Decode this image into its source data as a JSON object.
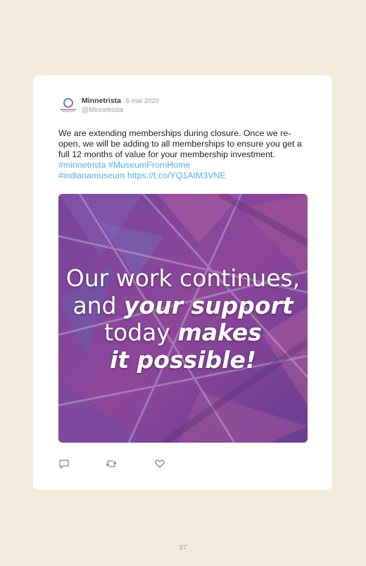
{
  "tweet": {
    "author_name": "Minnetrista",
    "separator": "·",
    "date": "6 mai 2020",
    "handle": "@Minnetrista",
    "text_plain": "We are extending memberships during closure. Once we re-open, we will be adding to all memberships to ensure you get a full 12 months of value for your membership investment.",
    "hashtag_1": "#minnetrista",
    "hashtag_2": "#MuseumFromHome",
    "hashtag_3": "#indianamuseum",
    "link": "https://t.co/YQ1AtM3VNE"
  },
  "media": {
    "line1": "Our work continues,",
    "line2_a": "and ",
    "line2_b": "your support",
    "line3_a": "today ",
    "line3_b": "makes",
    "line4": "it possible!"
  },
  "actions": {
    "reply_icon": "reply-icon",
    "retweet_icon": "retweet-icon",
    "like_icon": "heart-icon"
  },
  "page": {
    "number": "97"
  },
  "colors": {
    "background": "#f1ecdc",
    "link": "#55acee",
    "card": "#ffffff"
  }
}
